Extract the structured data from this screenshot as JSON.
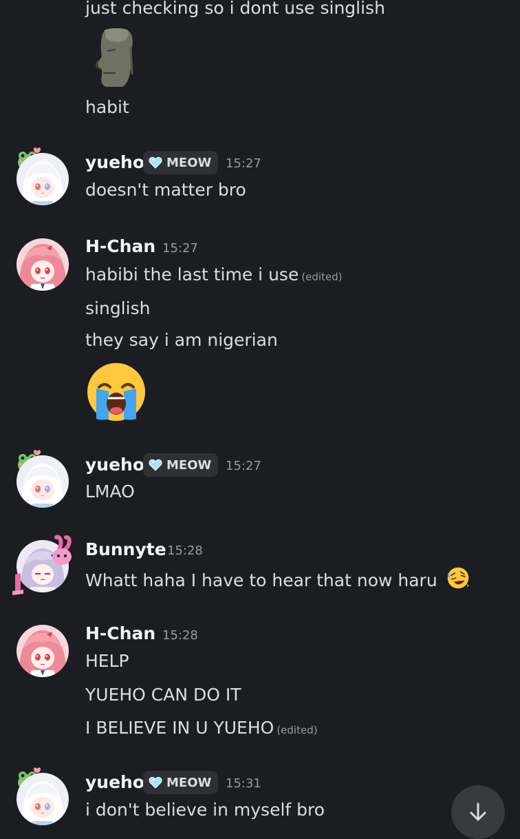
{
  "messages": {
    "m1": {
      "line1": "just checking so i dont use singlish",
      "line2": "habit",
      "emoji": "moai-emoji"
    },
    "m2": {
      "author": "yueho",
      "tag": "MEOW",
      "time": "15:27",
      "line1": "doesn't matter bro"
    },
    "m3": {
      "author": "H-Chan",
      "time": "15:27",
      "line1": "habibi the last time i use",
      "edited": "(edited)",
      "line2": "singlish",
      "line3": "they say i am nigerian",
      "emoji": "loudly-crying-emoji"
    },
    "m4": {
      "author": "yueho",
      "tag": "MEOW",
      "time": "15:27",
      "line1": "LMAO"
    },
    "m5": {
      "author": "Bunnyte",
      "time": "15:28",
      "line1": "Whatt haha I have to hear that now haru",
      "emoji": "rolling-laughing-emoji"
    },
    "m6": {
      "author": "H-Chan",
      "time": "15:28",
      "line1": "HELP",
      "line2": "YUEHO CAN DO IT",
      "line3": "I BELIEVE IN U YUEHO",
      "edited": "(edited)"
    },
    "m7": {
      "author": "yueho",
      "tag": "MEOW",
      "time": "15:31",
      "line1": "i don't believe in myself bro"
    }
  },
  "colors": {
    "background": "#1c1d22",
    "text": "#dbdee1",
    "muted": "#949ba4",
    "tag_bg": "#2e3036",
    "heart": "#a6e3f5"
  },
  "icons": {
    "scroll": "arrow-down-icon",
    "tag": "heart-icon"
  }
}
